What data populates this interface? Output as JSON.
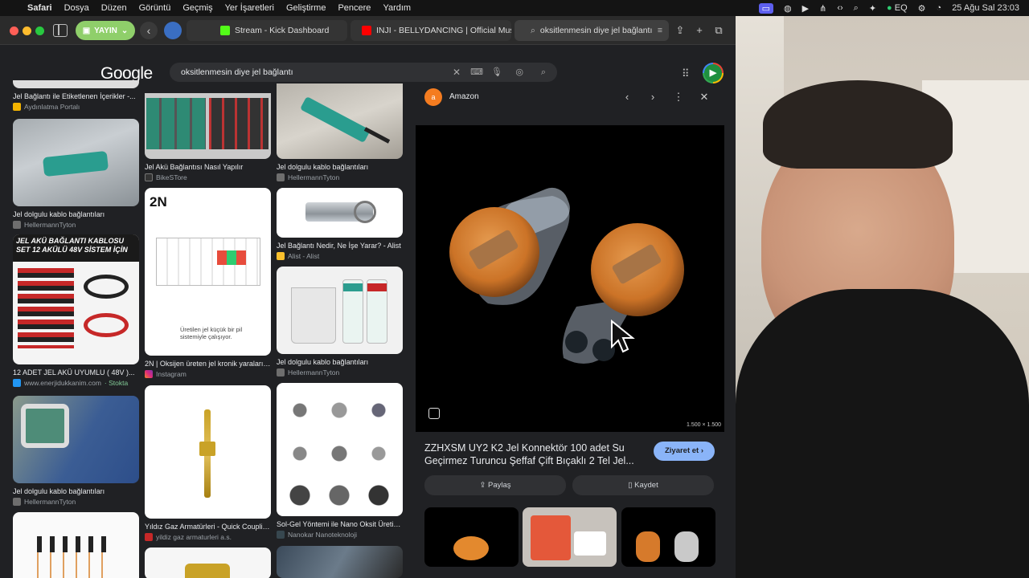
{
  "menubar": {
    "items": [
      "Safari",
      "Dosya",
      "Düzen",
      "Görüntü",
      "Geçmiş",
      "Yer İşaretleri",
      "Geliştirme",
      "Pencere",
      "Yardım"
    ],
    "status": {
      "eq": "EQ",
      "date": "25 Ağu Sal",
      "time": "23:03"
    }
  },
  "browser": {
    "profile_label": "YAYIN",
    "tabs": [
      {
        "label": "Stream - Kick Dashboard",
        "favicon_color": "#53fc18"
      },
      {
        "label": "INJI - BELLYDANCING | Official Music...",
        "favicon_color": "#ff0000"
      },
      {
        "label": "oksitlenmesin diye jel bağlantı",
        "favicon_color": "#9aa0a6"
      }
    ]
  },
  "google": {
    "logo": "Google",
    "query": "oksitlenmesin diye jel bağlantı",
    "avatar_letter": "▶"
  },
  "results": {
    "col1": [
      {
        "title": "Jel Bağlantı ile Etiketlenen İçerikler -...",
        "source": "Aydınlatma Portalı",
        "src_color": "#f4b400"
      },
      {
        "title": "Jel dolgulu kablo bağlantıları",
        "source": "HellermannTyton",
        "src_color": "#6e6e6e"
      },
      {
        "title": "12 ADET JEL AKÜ UYUMLU ( 48V )...",
        "source": "www.enerjidukkanim.com",
        "stock": "· Stokta",
        "src_color": "#2196f3",
        "image_text": "JEL AKÜ BAĞLANTI KABLOSU SET 12 AKÜLÜ 48V SİSTEM İÇİN"
      },
      {
        "title": "Jel dolgulu kablo bağlantıları",
        "source": "HellermannTyton",
        "src_color": "#6e6e6e"
      },
      {
        "title": "",
        "source": "",
        "src_color": "#6e6e6e"
      }
    ],
    "col2": [
      {
        "title": "Jel Akü Bağlantısı Nasıl Yapılır",
        "source": "BikeSTore",
        "src_color": "#333"
      },
      {
        "title": "2N | Oksijen üreten jel kronik yaraların...",
        "source": "Instagram",
        "src_color": "#e1306c",
        "image_text": "Üretilen jel küçük bir pil sistemiyle çalışıyor.",
        "brand": "2N"
      },
      {
        "title": "Yıldız Gaz Armatürleri - Quick Couplin...",
        "source": "yildiz gaz armaturleri a.s.",
        "src_color": "#c62828"
      },
      {
        "title": "",
        "source": "",
        "src_color": "#333"
      }
    ],
    "col3": [
      {
        "title": "Jel dolgulu kablo bağlantıları",
        "source": "HellermannTyton",
        "src_color": "#6e6e6e"
      },
      {
        "title": "Jel Bağlantı Nedir, Ne İşe Yarar? - Alist",
        "source": "Alist - Alist",
        "src_color": "#fbc02d"
      },
      {
        "title": "Jel dolgulu kablo bağlantıları",
        "source": "HellermannTyton",
        "src_color": "#6e6e6e"
      },
      {
        "title": "Sol-Gel Yöntemi ile Nano Oksit Üretimi ...",
        "source": "Nanokar Nanoteknoloji",
        "src_color": "#37474f"
      },
      {
        "title": "",
        "source": "",
        "src_color": "#333"
      }
    ]
  },
  "panel": {
    "source": "Amazon",
    "source_initial": "a",
    "dimensions": "1.500 × 1.500",
    "title": "ZZHXSM UY2 K2 Jel Konnektör 100 adet Su Geçirmez Turuncu Şeffaf Çift Bıçaklı 2 Tel Jel...",
    "visit_label": "Ziyaret et",
    "share_label": "Paylaş",
    "save_label": "Kaydet"
  }
}
